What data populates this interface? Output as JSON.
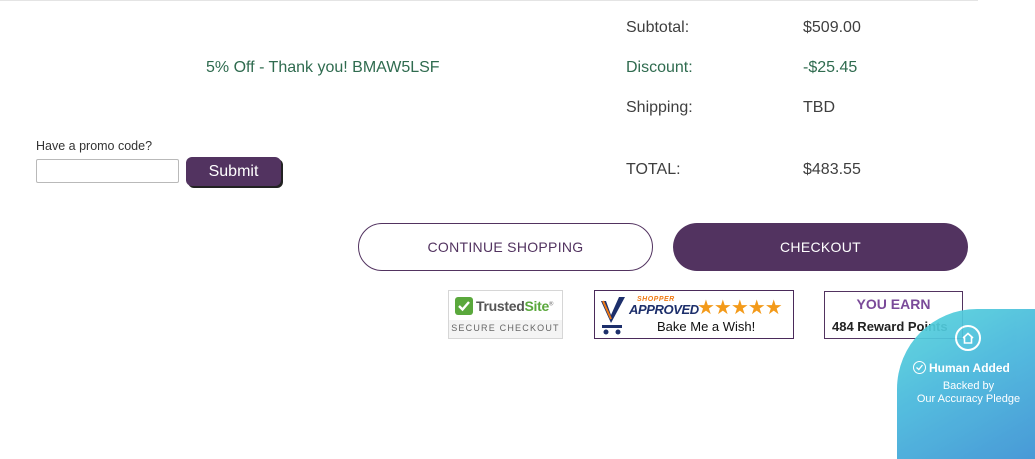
{
  "promo_message": "5% Off - Thank you! BMAW5LSF",
  "summary": {
    "subtotal_label": "Subtotal:",
    "subtotal_value": "$509.00",
    "discount_label": "Discount:",
    "discount_value": "-$25.45",
    "shipping_label": "Shipping:",
    "shipping_value": "TBD",
    "total_label": "TOTAL:",
    "total_value": "$483.55"
  },
  "promo_form": {
    "label": "Have a promo code?",
    "input_value": "",
    "submit_label": "Submit"
  },
  "buttons": {
    "continue_shopping": "CONTINUE SHOPPING",
    "checkout": "CHECKOUT"
  },
  "badges": {
    "trusted_site": {
      "name_part1": "Trusted",
      "name_part2": "Site",
      "trademark": "®",
      "subtitle": "SECURE CHECKOUT"
    },
    "shopper_approved": {
      "tag": "SHOPPER",
      "brand": "APPROVED",
      "stars": "★★★★★",
      "store": "Bake Me a Wish!"
    },
    "reward": {
      "title": "YOU EARN",
      "points": "484 Reward Points"
    }
  },
  "human_widget": {
    "title": "Human Added",
    "line1": "Backed by",
    "line2": "Our Accuracy Pledge",
    "icon": "home-icon"
  },
  "colors": {
    "brand_purple": "#523360",
    "promo_green": "#2f6b4f",
    "star_orange": "#f39a1a",
    "trusted_green": "#5aa83c"
  }
}
